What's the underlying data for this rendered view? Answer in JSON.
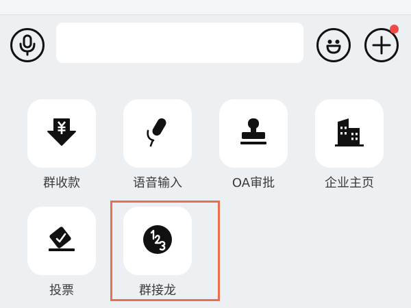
{
  "input_bar": {
    "voice_icon": "microphone-icon",
    "emoji_icon": "smiley-icon",
    "more_icon": "plus-icon",
    "message_value": "",
    "has_notification": true
  },
  "features": [
    {
      "label": "群收款",
      "icon": "group-payment-icon"
    },
    {
      "label": "语音输入",
      "icon": "voice-input-icon"
    },
    {
      "label": "OA审批",
      "icon": "stamp-icon"
    },
    {
      "label": "企业主页",
      "icon": "building-icon"
    },
    {
      "label": "投票",
      "icon": "vote-icon"
    },
    {
      "label": "群接龙",
      "icon": "group-chain-icon"
    }
  ],
  "colors": {
    "background": "#edf0f2",
    "tile": "#ffffff",
    "icon": "#111111",
    "badge": "#f04a46",
    "highlight": "#e8704f"
  }
}
